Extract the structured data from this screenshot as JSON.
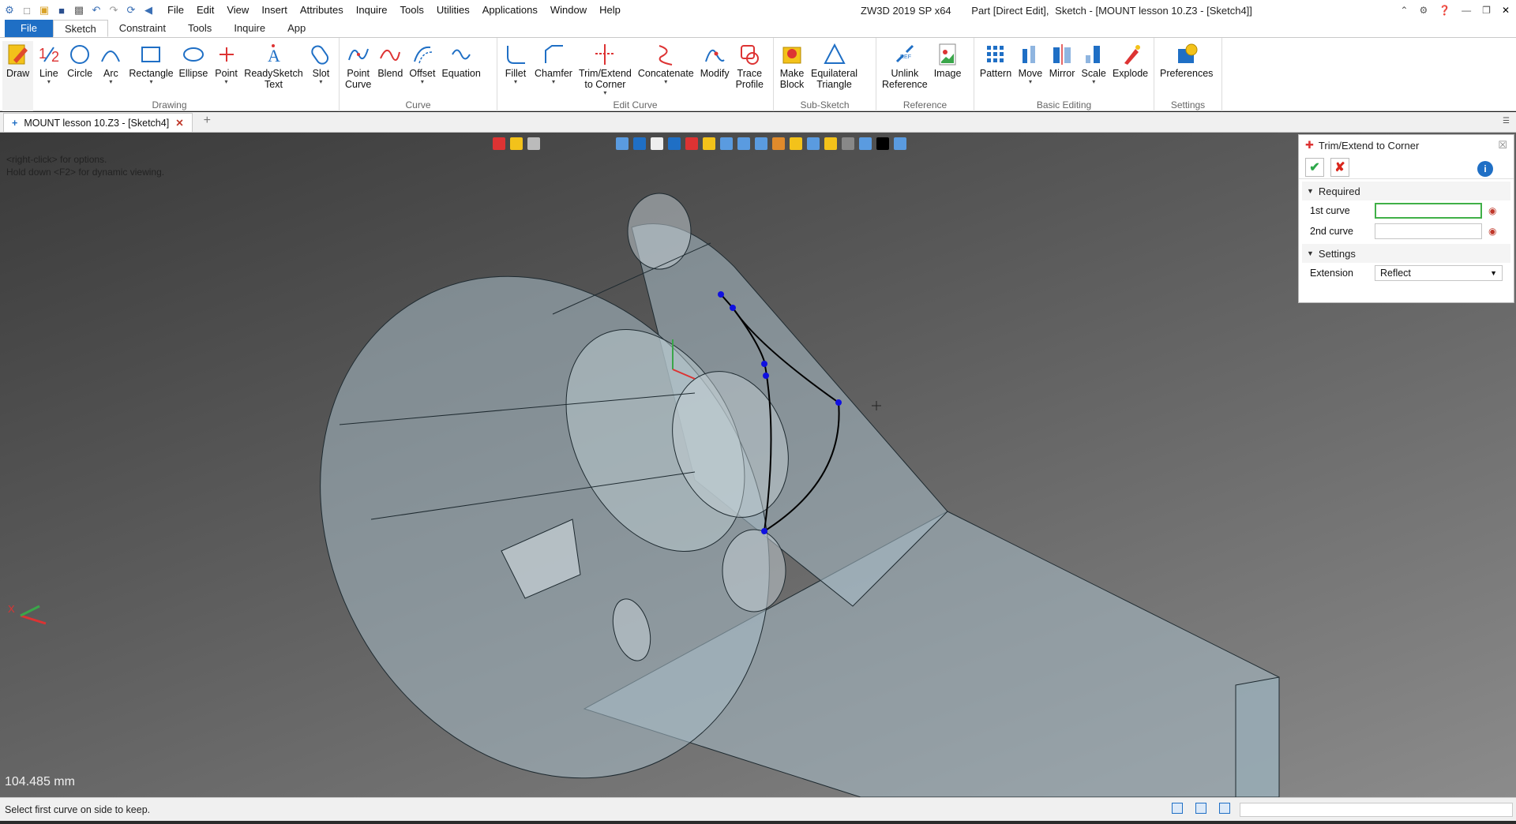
{
  "app": {
    "product": "ZW3D 2019 SP x64",
    "context": "Part [Direct Edit],",
    "document_title": "Sketch - [MOUNT lesson 10.Z3 - [Sketch4]]"
  },
  "menu": [
    "File",
    "Edit",
    "View",
    "Insert",
    "Attributes",
    "Inquire",
    "Tools",
    "Utilities",
    "Applications",
    "Window",
    "Help"
  ],
  "ribbon_tabs": [
    "File",
    "Sketch",
    "Constraint",
    "Tools",
    "Inquire",
    "App"
  ],
  "ribbon_active_tab": "Sketch",
  "ribbon": {
    "drawing": {
      "label": "Drawing",
      "buttons": [
        "Draw",
        "Line",
        "Circle",
        "Arc",
        "Rectangle",
        "Ellipse",
        "Point",
        "ReadySketch\nText",
        "Slot"
      ]
    },
    "curve": {
      "label": "Curve",
      "buttons": [
        "Point\nCurve",
        "Blend",
        "Offset",
        "Equation"
      ]
    },
    "edit_curve": {
      "label": "Edit Curve",
      "buttons": [
        "Fillet",
        "Chamfer",
        "Trim/Extend\nto Corner",
        "Concatenate",
        "Modify",
        "Trace\nProfile"
      ]
    },
    "sub_sketch": {
      "label": "Sub-Sketch",
      "buttons": [
        "Make\nBlock",
        "Equilateral\nTriangle"
      ]
    },
    "reference": {
      "label": "Reference",
      "buttons": [
        "Unlink\nReference",
        "Image"
      ]
    },
    "basic_editing": {
      "label": "Basic Editing",
      "buttons": [
        "Pattern",
        "Move",
        "Mirror",
        "Scale",
        "Explode"
      ]
    },
    "settings": {
      "label": "Settings",
      "buttons": [
        "Preferences"
      ]
    }
  },
  "doc_tab": {
    "label": "MOUNT lesson 10.Z3 - [Sketch4]"
  },
  "viewport": {
    "hint_line1": "<right-click> for options.",
    "hint_line2": "Hold down <F2> for dynamic viewing.",
    "measurement": "104.485 mm",
    "axis_x": "X"
  },
  "panel": {
    "title": "Trim/Extend to Corner",
    "required_label": "Required",
    "first_curve_label": "1st curve",
    "first_curve_value": "",
    "second_curve_label": "2nd curve",
    "second_curve_value": "",
    "settings_label": "Settings",
    "extension_label": "Extension",
    "extension_value": "Reflect"
  },
  "status": {
    "prompt": "Select first curve on side to keep."
  },
  "colors": {
    "accent": "#1f6fc5",
    "ok": "#2da84a",
    "cancel": "#d9261c",
    "sketch_point": "#1010e0",
    "field_focus": "#40b048"
  }
}
